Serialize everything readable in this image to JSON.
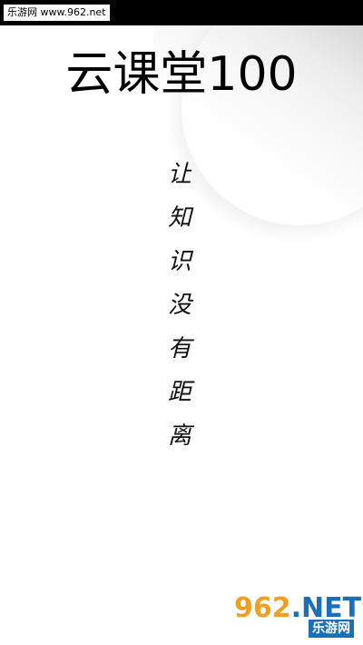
{
  "status_bar": {
    "watermark_text": "乐游网 www.962.net"
  },
  "app": {
    "title": "云课堂100"
  },
  "slogan": {
    "characters": [
      "让",
      "知",
      "识",
      "没",
      "有",
      "距",
      "离"
    ]
  },
  "watermark": {
    "logo_digits": "962",
    "logo_suffix": ".NET",
    "site_name": "乐游网",
    "colors": {
      "digits": "#f0a020",
      "suffix": "#1b6fb8",
      "sub_bg": "#1b6fb8"
    }
  }
}
